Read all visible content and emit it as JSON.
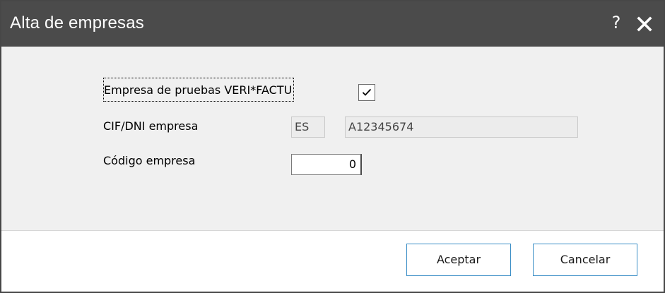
{
  "window": {
    "title": "Alta de empresas",
    "help_label": "?",
    "icons": {
      "help": "question-icon",
      "close": "close-icon"
    }
  },
  "form": {
    "test_company": {
      "label": "Empresa de pruebas VERI*FACTU",
      "checked": true
    },
    "cif": {
      "label": "CIF/DNI empresa",
      "country": "ES",
      "value": "A12345674"
    },
    "company_code": {
      "label": "Código empresa",
      "value": "0"
    }
  },
  "footer": {
    "accept_label": "Aceptar",
    "cancel_label": "Cancelar"
  },
  "colors": {
    "titlebar": "#4b4b4b",
    "body": "#f0f0f0",
    "footer": "#ffffff",
    "button_border": "#3b8ec6"
  }
}
